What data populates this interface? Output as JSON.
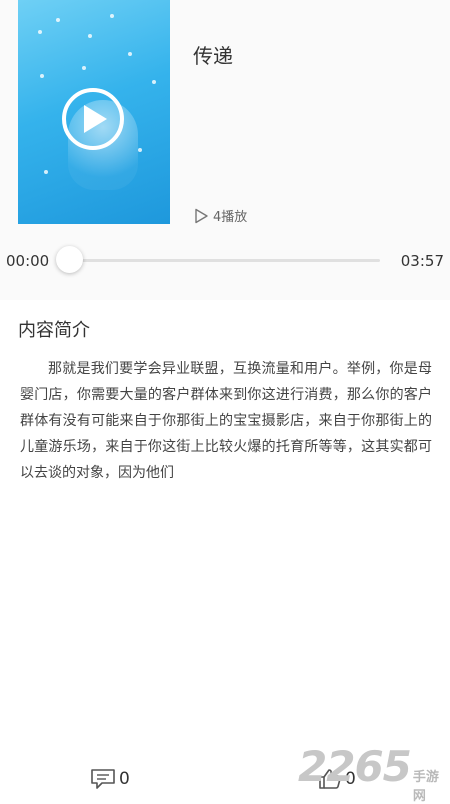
{
  "track": {
    "title": "传递",
    "play_count": "4播放"
  },
  "player": {
    "current_time": "00:00",
    "total_time": "03:57",
    "progress": 0
  },
  "intro": {
    "heading": "内容简介",
    "text": "那就是我们要学会异业联盟，互换流量和用户。举例，你是母婴门店，你需要大量的客户群体来到你这进行消费，那么你的客户群体有没有可能来自于你那街上的宝宝摄影店，来自于你那街上的儿童游乐场，来自于你这街上比较火爆的托育所等等，这其实都可以去谈的对象，因为他们"
  },
  "bottom_bar": {
    "comment_count": "0",
    "like_count": "0"
  },
  "watermark": {
    "number": "2265",
    "site": "手游网"
  },
  "icons": {
    "cover_play": "play-circle-icon",
    "plays": "play-outline-icon",
    "comment": "comment-icon",
    "like": "thumbs-up-icon"
  },
  "colors": {
    "cover_blue": "#35b3ec",
    "text": "#333333"
  }
}
